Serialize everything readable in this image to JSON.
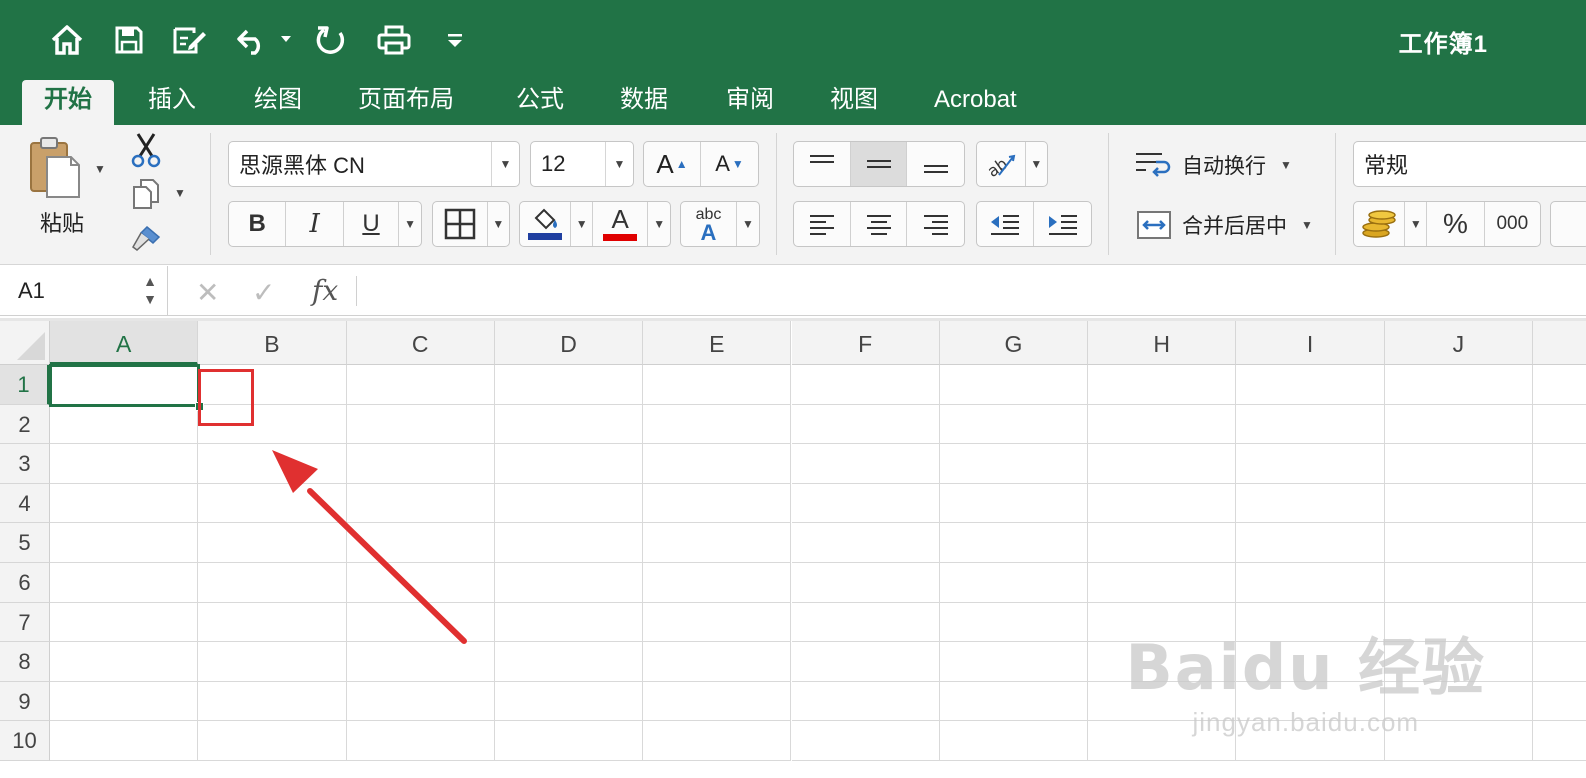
{
  "title_bar": {
    "workbook_title": "工作簿1",
    "quick_access": [
      {
        "name": "home-icon"
      },
      {
        "name": "save-icon"
      },
      {
        "name": "edit-icon"
      },
      {
        "name": "undo-icon"
      },
      {
        "name": "redo-icon"
      },
      {
        "name": "print-icon"
      },
      {
        "name": "customize-icon"
      }
    ]
  },
  "ribbon_tabs": [
    {
      "label": "开始",
      "active": true
    },
    {
      "label": "插入"
    },
    {
      "label": "绘图"
    },
    {
      "label": "页面布局"
    },
    {
      "label": "公式"
    },
    {
      "label": "数据"
    },
    {
      "label": "审阅"
    },
    {
      "label": "视图"
    },
    {
      "label": "Acrobat"
    }
  ],
  "ribbon": {
    "paste_label": "粘贴",
    "font_name": "思源黑体 CN",
    "font_size": "12",
    "bold": "B",
    "italic": "I",
    "underline": "U",
    "font_color_glyph": "A",
    "grow_font": "A",
    "shrink_font": "A",
    "phonetic_top": "abc",
    "phonetic_bottom": "A",
    "wrap_text": "自动换行",
    "merge_center": "合并后居中",
    "number_format": "常规",
    "percent": "%",
    "comma": "000"
  },
  "colors": {
    "brand": "#217346",
    "fill_color": "#1f3fa0",
    "font_color": "#e00000",
    "annotation": "#e03030"
  },
  "formula_bar": {
    "name_box": "A1",
    "fx": "fx",
    "formula": ""
  },
  "sheet": {
    "columns": [
      "A",
      "B",
      "C",
      "D",
      "E",
      "F",
      "G",
      "H",
      "I",
      "J"
    ],
    "rows": [
      "1",
      "2",
      "3",
      "4",
      "5",
      "6",
      "7",
      "8",
      "9",
      "10"
    ],
    "active_cell": "A1"
  },
  "watermark": {
    "brand": "Baidu 经验",
    "url": "jingyan.baidu.com"
  }
}
